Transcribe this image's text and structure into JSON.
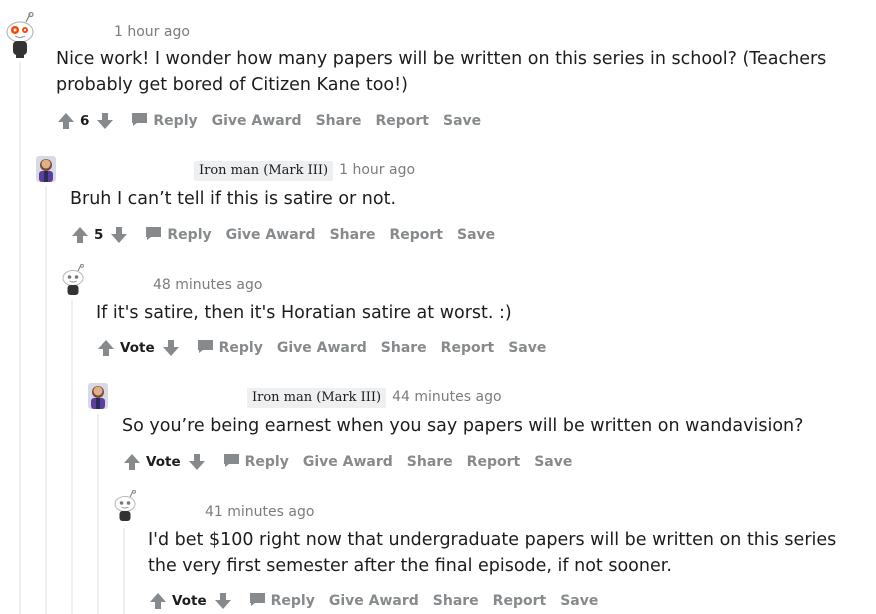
{
  "comments": [
    {
      "avatar": "snoo-avatar-orange",
      "flair": "",
      "time": "1 hour ago",
      "text": "Nice work! I wonder how many papers will be written on this series in school? (Teachers probably get bored of Citizen Kane too!)",
      "score": "6",
      "actions": [
        "Reply",
        "Give Award",
        "Share",
        "Report",
        "Save"
      ]
    },
    {
      "avatar": "iron-man-avatar",
      "flair": "Iron man (Mark III)",
      "time": "1 hour ago",
      "text": "Bruh I can’t tell if this is satire or not.",
      "score": "5",
      "actions": [
        "Reply",
        "Give Award",
        "Share",
        "Report",
        "Save"
      ]
    },
    {
      "avatar": "snoo-avatar-grey",
      "flair": "",
      "time": "48 minutes ago",
      "text": "If it's satire, then it's Horatian satire at worst. :)",
      "score": "Vote",
      "actions": [
        "Reply",
        "Give Award",
        "Share",
        "Report",
        "Save"
      ]
    },
    {
      "avatar": "iron-man-avatar",
      "flair": "Iron man (Mark III)",
      "time": "44 minutes ago",
      "text": "So you’re being earnest when you say papers will be written on wandavision?",
      "score": "Vote",
      "actions": [
        "Reply",
        "Give Award",
        "Share",
        "Report",
        "Save"
      ]
    },
    {
      "avatar": "snoo-avatar-grey",
      "flair": "",
      "time": "41 minutes ago",
      "text": "I'd bet $100 right now that undergraduate papers will be written on this series the very first semester after the final episode, if not sooner.",
      "score": "Vote",
      "actions": [
        "Reply",
        "Give Award",
        "Share",
        "Report",
        "Save"
      ]
    }
  ]
}
